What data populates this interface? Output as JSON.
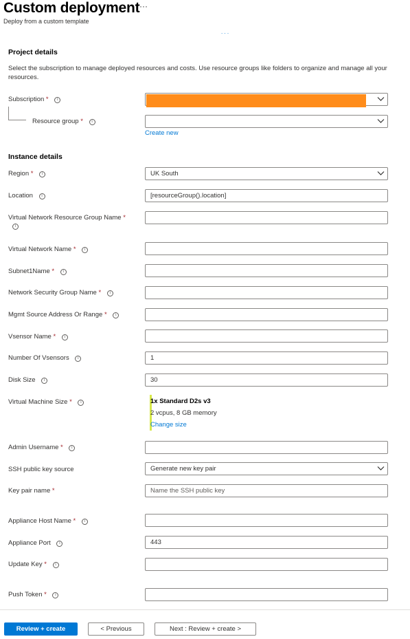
{
  "header": {
    "title": "Custom deployment",
    "more_icon": "more-ellipsis-icon",
    "more_label": "···",
    "subtitle": "Deploy from a custom template",
    "tab_markers": ".   .   ."
  },
  "project": {
    "heading": "Project details",
    "description": "Select the subscription to manage deployed resources and costs. Use resource groups like folders to organize and manage all your resources.",
    "subscription": {
      "label": "Subscription",
      "required": "*",
      "value": "",
      "redacted_color": "#ff8c1a"
    },
    "resource_group": {
      "label": "Resource group",
      "required": "*",
      "value": "",
      "create_new_label": "Create new"
    }
  },
  "instance": {
    "heading": "Instance details",
    "region": {
      "label": "Region",
      "required": "*",
      "value": "UK South"
    },
    "location": {
      "label": "Location",
      "value": "[resourceGroup().location]"
    },
    "vnet_rg_name": {
      "label": "Virtual Network Resource Group Name",
      "required": "*",
      "value": ""
    },
    "vnet_name": {
      "label": "Virtual Network Name",
      "required": "*",
      "value": ""
    },
    "subnet1_name": {
      "label": "Subnet1Name",
      "required": "*",
      "value": ""
    },
    "nsg_name": {
      "label": "Network Security Group Name",
      "required": "*",
      "value": ""
    },
    "mgmt_source": {
      "label": "Mgmt Source Address Or Range",
      "required": "*",
      "value": ""
    },
    "vsensor_name": {
      "label": "Vsensor Name",
      "required": "*",
      "value": ""
    },
    "num_vsensors": {
      "label": "Number Of Vsensors",
      "value": "1"
    },
    "disk_size": {
      "label": "Disk Size",
      "value": "30"
    },
    "vm_size": {
      "label": "Virtual Machine Size",
      "required": "*",
      "size_name": "1x Standard D2s v3",
      "size_detail": "2 vcpus, 8 GB memory",
      "change_label": "Change size"
    },
    "admin_username": {
      "label": "Admin Username",
      "required": "*",
      "value": ""
    },
    "ssh_source": {
      "label": "SSH public key source",
      "value": "Generate new key pair"
    },
    "key_pair_name": {
      "label": "Key pair name",
      "required": "*",
      "value": "",
      "placeholder": "Name the SSH public key"
    },
    "appliance_host": {
      "label": "Appliance Host Name",
      "required": "*",
      "value": ""
    },
    "appliance_port": {
      "label": "Appliance Port",
      "value": "443"
    },
    "update_key": {
      "label": "Update Key",
      "required": "*",
      "value": ""
    },
    "push_token": {
      "label": "Push Token",
      "required": "*",
      "value": ""
    }
  },
  "footer": {
    "review_create": "Review + create",
    "previous": "< Previous",
    "next": "Next : Review + create >"
  },
  "icons": {
    "info": "i"
  }
}
